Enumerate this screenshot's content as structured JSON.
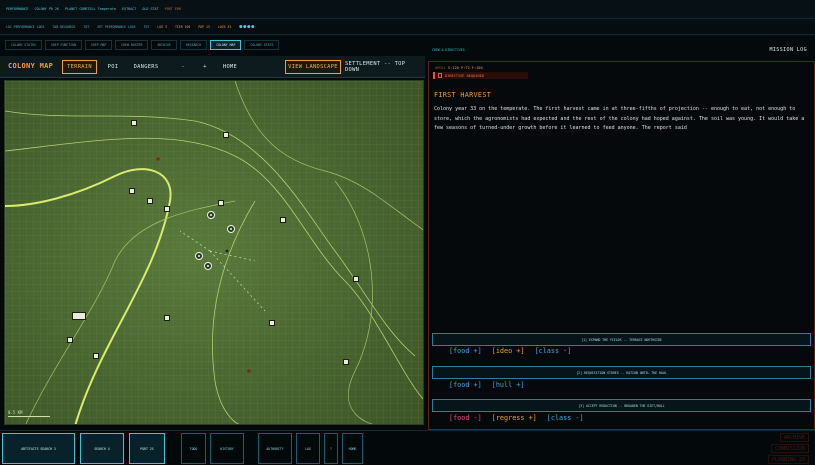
{
  "topbar": {
    "items": [
      "PERFORMANCE",
      "COLONY PR 2K",
      "PLANET COMETELL Temperate",
      "EXTRACT",
      "OLD STAT"
    ],
    "accent": "PORT ERR"
  },
  "statusbar": {
    "items": [
      "LOC PERFORMANCE LOGS",
      "TAB RESOURCE",
      "TOT",
      "SET PERFORMANCE LOGS",
      "TOT"
    ],
    "stats": [
      "LOG 3",
      "TIER 109",
      "POP 13",
      "LOCK 33"
    ],
    "dots": "●●●●"
  },
  "tabs": [
    "COLONY STATUS",
    "SHIP FUNCTION",
    "SHIP MAP",
    "CREW ROSTER",
    "ARCHIVE",
    "RESEARCH",
    "COLONY MAP",
    "COLONY STATS"
  ],
  "active_tab": 6,
  "map_header": {
    "title": "COLONY MAP",
    "terrain": "TERRAIN",
    "poi": "POI",
    "dangers": "DANGERS",
    "minus": "-",
    "plus": "+",
    "home": "HOME",
    "view_landscape": "VIEW LANDSCAPE",
    "mode": "SETTLEMENT -- TOP DOWN"
  },
  "map": {
    "scale_label": "0.5 KM",
    "terrain_color": "#4b6633",
    "grid_color": "#8fb36a",
    "contour_color": "#cde07a"
  },
  "right_panel": {
    "tag": "CREW & DIRECTIVES",
    "title": "MISSION LOG",
    "meta_dim": "APRIL",
    "meta": "S:120  P:72  F:100",
    "directive": "DIRECTIVE REQUIRED",
    "heading": "FIRST HARVEST",
    "body": "Colony year 33 on the temperate. The first harvest came in at three-fifths of projection -- enough to eat, not enough to store, which the agronomists had expected and the rest of the colony had hoped against. The soil was young. It would take a few seasons of turned-under growth before it learned to feed anyone. The report said"
  },
  "choices": [
    {
      "label": "[1]  EXPAND THE FIELDS -- TERRACE NORTHSIDE",
      "effects": [
        {
          "text": "[food +]",
          "tone": "b"
        },
        {
          "text": "[ideo +]",
          "tone": "o"
        },
        {
          "text": "[class -]",
          "tone": "b"
        }
      ]
    },
    {
      "label": "[2]  REQUISITION STORES -- RATION UNTIL THE HAUL",
      "effects": [
        {
          "text": "[food +]",
          "tone": "b"
        },
        {
          "text": "[hull +]",
          "tone": "b"
        }
      ]
    },
    {
      "label": "[3]  ACCEPT REDUCTION -- BROADEN THE DIET/HULL",
      "effects": [
        {
          "text": "[food -]",
          "tone": "r"
        },
        {
          "text": "[regress +]",
          "tone": "o"
        },
        {
          "text": "[class -]",
          "tone": "b"
        }
      ]
    }
  ],
  "bottom": [
    "ARTIFACTS SEARCH 3",
    "SEARCH 4",
    "PORT 2S",
    "TODO",
    "HISTORY",
    "AUTHORITY",
    "LOG",
    "?",
    "HOME"
  ],
  "ghost": [
    "ARCHIVE",
    "COMMISSION",
    "PLANNING 20"
  ]
}
